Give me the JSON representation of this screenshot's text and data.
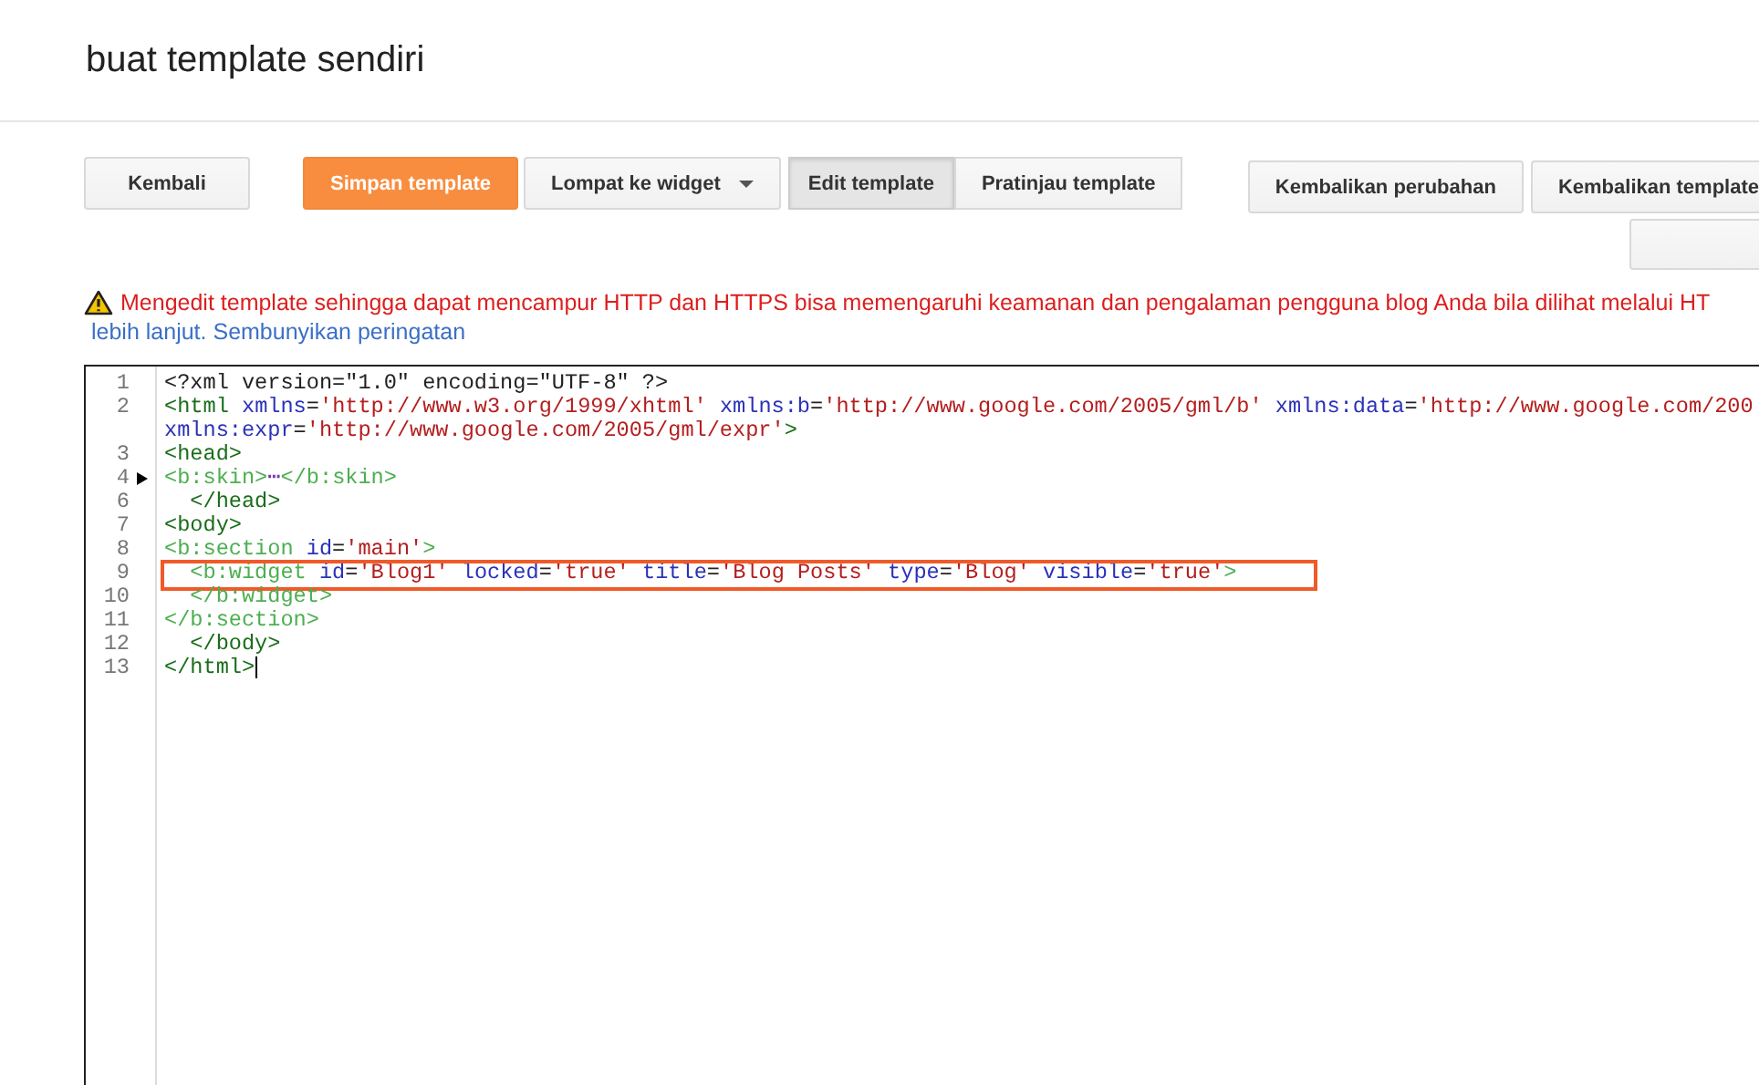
{
  "page_title": "buat template sendiri",
  "toolbar_left": [
    {
      "label": "Kembali",
      "kind": "plain"
    },
    {
      "label": "Simpan template",
      "kind": "primary"
    },
    {
      "label": "Lompat ke widget",
      "kind": "dropdown"
    }
  ],
  "view_tabs": [
    {
      "label": "Edit template",
      "selected": true
    },
    {
      "label": "Pratinjau template",
      "selected": false
    }
  ],
  "toolbar_right": [
    "Kembalikan perubahan",
    "Kembalikan template"
  ],
  "warning": {
    "message": "Mengedit template sehingga dapat mencampur HTTP dan HTTPS bisa memengaruhi keamanan dan pengalaman pengguna blog Anda bila dilihat melalui HT",
    "more_link": "lebih lanjut.",
    "hide_link": "Sembunyikan peringatan"
  },
  "editor": {
    "lines": [
      {
        "number": "1",
        "folded": false,
        "highlighted": false,
        "rows": [
          {
            "tokens": [
              {
                "kind": "plain",
                "text": "<?xml version=\"1.0\" encoding=\"UTF-8\" ?>"
              }
            ]
          }
        ]
      },
      {
        "number": "2",
        "folded": false,
        "highlighted": false,
        "rows": [
          {
            "tokens": [
              {
                "kind": "tag",
                "text": "<html "
              },
              {
                "kind": "attr",
                "text": "xmlns"
              },
              {
                "kind": "plain",
                "text": "="
              },
              {
                "kind": "value",
                "text": "'http://www.w3.org/1999/xhtml'"
              },
              {
                "kind": "attr",
                "text": " xmlns:b"
              },
              {
                "kind": "plain",
                "text": "="
              },
              {
                "kind": "value",
                "text": "'http://www.google.com/2005/gml/b'"
              },
              {
                "kind": "attr",
                "text": " xmlns:data"
              },
              {
                "kind": "plain",
                "text": "="
              },
              {
                "kind": "value",
                "text": "'http://www.google.com/200"
              }
            ]
          },
          {
            "tokens": [
              {
                "kind": "attr",
                "text": "xmlns:expr"
              },
              {
                "kind": "plain",
                "text": "="
              },
              {
                "kind": "value",
                "text": "'http://www.google.com/2005/gml/expr'"
              },
              {
                "kind": "tag",
                "text": ">"
              }
            ]
          }
        ]
      },
      {
        "number": "3",
        "folded": false,
        "highlighted": false,
        "rows": [
          {
            "tokens": [
              {
                "kind": "tag",
                "text": "<head>"
              }
            ]
          }
        ]
      },
      {
        "number": "4",
        "folded": true,
        "highlighted": false,
        "rows": [
          {
            "tokens": [
              {
                "kind": "btag",
                "text": "<b:skin>"
              },
              {
                "kind": "fold",
                "text": "⋯"
              },
              {
                "kind": "btag",
                "text": "</b:skin>"
              }
            ]
          }
        ]
      },
      {
        "number": "6",
        "folded": false,
        "highlighted": false,
        "rows": [
          {
            "tokens": [
              {
                "kind": "tag",
                "text": "  </head>"
              }
            ]
          }
        ]
      },
      {
        "number": "7",
        "folded": false,
        "highlighted": false,
        "rows": [
          {
            "tokens": [
              {
                "kind": "tag",
                "text": "<body>"
              }
            ]
          }
        ]
      },
      {
        "number": "8",
        "folded": false,
        "highlighted": false,
        "rows": [
          {
            "tokens": [
              {
                "kind": "btag",
                "text": "<b:section "
              },
              {
                "kind": "attr",
                "text": "id"
              },
              {
                "kind": "plain",
                "text": "="
              },
              {
                "kind": "value",
                "text": "'main'"
              },
              {
                "kind": "btag",
                "text": ">"
              }
            ]
          }
        ]
      },
      {
        "number": "9",
        "folded": false,
        "highlighted": true,
        "rows": [
          {
            "tokens": [
              {
                "kind": "btag",
                "text": "  <b:widget "
              },
              {
                "kind": "attr",
                "text": "id"
              },
              {
                "kind": "plain",
                "text": "="
              },
              {
                "kind": "value",
                "text": "'Blog1'"
              },
              {
                "kind": "attr",
                "text": " locked"
              },
              {
                "kind": "plain",
                "text": "="
              },
              {
                "kind": "value",
                "text": "'true'"
              },
              {
                "kind": "attr",
                "text": " title"
              },
              {
                "kind": "plain",
                "text": "="
              },
              {
                "kind": "value",
                "text": "'Blog Posts'"
              },
              {
                "kind": "attr",
                "text": " type"
              },
              {
                "kind": "plain",
                "text": "="
              },
              {
                "kind": "value",
                "text": "'Blog'"
              },
              {
                "kind": "attr",
                "text": " visible"
              },
              {
                "kind": "plain",
                "text": "="
              },
              {
                "kind": "value",
                "text": "'true'"
              },
              {
                "kind": "btag",
                "text": ">"
              }
            ]
          }
        ]
      },
      {
        "number": "10",
        "folded": false,
        "highlighted": false,
        "rows": [
          {
            "tokens": [
              {
                "kind": "btag",
                "text": "  </b:widget>"
              }
            ]
          }
        ]
      },
      {
        "number": "11",
        "folded": false,
        "highlighted": false,
        "rows": [
          {
            "tokens": [
              {
                "kind": "btag",
                "text": "</b:section>"
              }
            ]
          }
        ]
      },
      {
        "number": "12",
        "folded": false,
        "highlighted": false,
        "rows": [
          {
            "tokens": [
              {
                "kind": "tag",
                "text": "  </body>"
              }
            ]
          }
        ]
      },
      {
        "number": "13",
        "folded": false,
        "highlighted": false,
        "rows": [
          {
            "tokens": [
              {
                "kind": "tag",
                "text": "</html>"
              }
            ]
          }
        ]
      }
    ]
  }
}
